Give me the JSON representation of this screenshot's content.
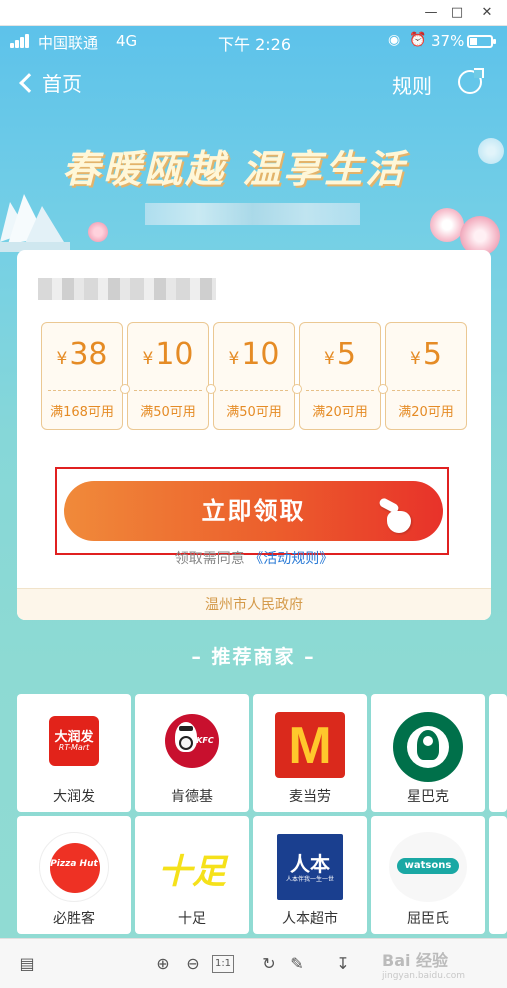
{
  "status_bar": {
    "carrier": "中国联通",
    "network": "4G",
    "time": "下午 2:26",
    "battery": "37%",
    "battery_level": 0.37
  },
  "nav": {
    "back_label": "首页",
    "rules_label": "规则"
  },
  "banner": {
    "title": "春暖瓯越 温享生活"
  },
  "coupons": [
    {
      "amount": "38",
      "condition": "满168可用"
    },
    {
      "amount": "10",
      "condition": "满50可用"
    },
    {
      "amount": "10",
      "condition": "满50可用"
    },
    {
      "amount": "5",
      "condition": "满20可用"
    },
    {
      "amount": "5",
      "condition": "满20可用"
    }
  ],
  "currency_symbol": "¥",
  "claim_button": "立即领取",
  "notice": {
    "text": "领取需同意",
    "link": "《活动规则》"
  },
  "issuer": "温州市人民政府",
  "merchants_section_title": "– 推荐商家 –",
  "merchants": [
    {
      "name": "大润发",
      "logo_text": "大润发",
      "logo_sub": "RT-Mart"
    },
    {
      "name": "肯德基",
      "logo_text": "KFC"
    },
    {
      "name": "麦当劳",
      "logo_text": "M"
    },
    {
      "name": "星巴克"
    },
    {
      "name": "必胜客",
      "logo_text": "Pizza Hut"
    },
    {
      "name": "十足",
      "logo_text": "十足"
    },
    {
      "name": "人本超市",
      "logo_text": "人本",
      "logo_sub": "人本伴我一生一世"
    },
    {
      "name": "屈臣氏",
      "logo_text": "watsons"
    }
  ],
  "watermark": {
    "brand": "Bai 经验",
    "domain": "jingyan.baidu.com"
  },
  "colors": {
    "accent_orange": "#e58b25",
    "button_start": "#f08a3a",
    "button_end": "#e8322a",
    "link_blue": "#2b7bd6",
    "highlight_frame": "#e02020",
    "kfc_red": "#c8102e",
    "mcd_red": "#da291c",
    "mcd_yellow": "#ffc72c",
    "starbucks_green": "#00704a",
    "watsons_teal": "#1aa8a4"
  }
}
